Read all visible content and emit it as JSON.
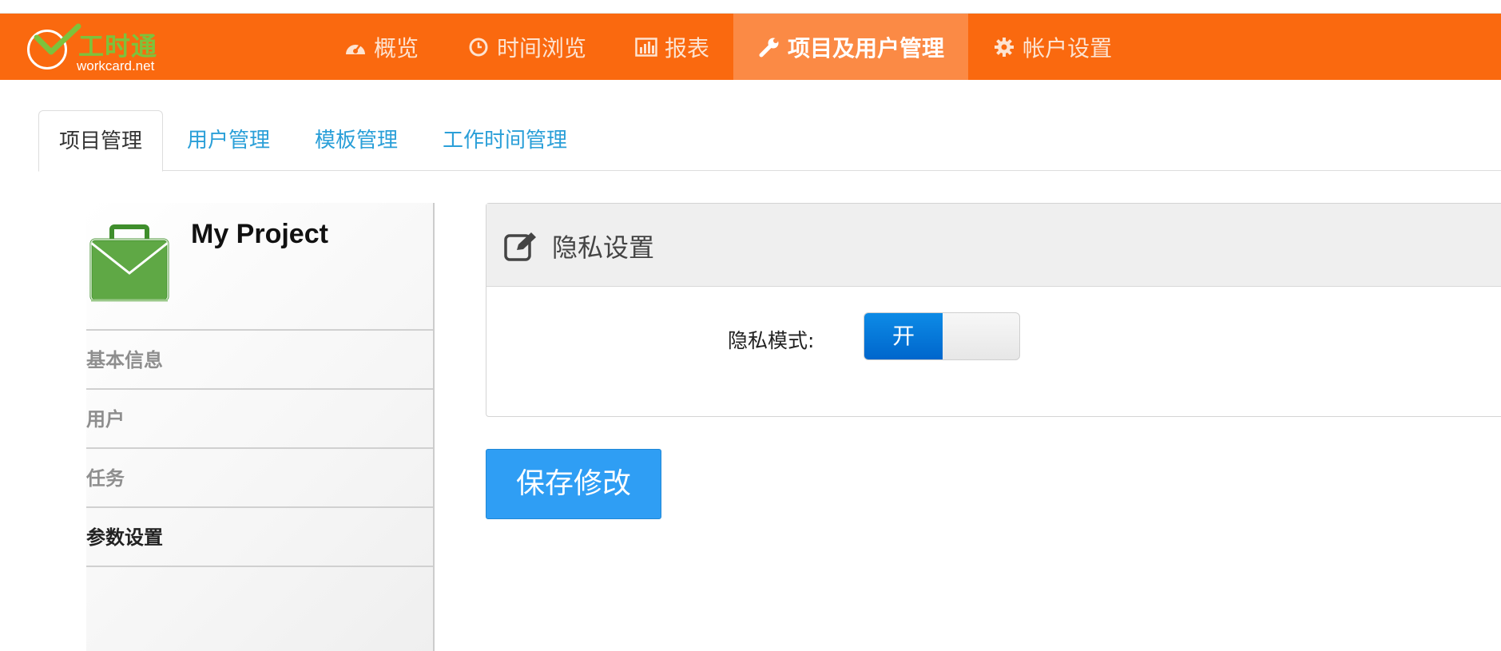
{
  "app": {
    "logo_cn": "工时通",
    "logo_en": "workcard.net"
  },
  "nav": {
    "items": [
      {
        "label": "概览",
        "icon": "dashboard-icon",
        "active": false
      },
      {
        "label": "时间浏览",
        "icon": "clock-icon",
        "active": false
      },
      {
        "label": "报表",
        "icon": "bar-chart-icon",
        "active": false
      },
      {
        "label": "项目及用户管理",
        "icon": "wrench-icon",
        "active": true
      },
      {
        "label": "帐户设置",
        "icon": "gear-icon",
        "active": false
      }
    ]
  },
  "tabs": [
    {
      "label": "项目管理",
      "active": true
    },
    {
      "label": "用户管理",
      "active": false
    },
    {
      "label": "模板管理",
      "active": false
    },
    {
      "label": "工作时间管理",
      "active": false
    }
  ],
  "sidebar": {
    "project_name": "My Project",
    "project_icon": "briefcase-icon",
    "items": [
      {
        "label": "基本信息",
        "active": false
      },
      {
        "label": "用户",
        "active": false
      },
      {
        "label": "任务",
        "active": false
      },
      {
        "label": "参数设置",
        "active": true
      }
    ]
  },
  "panel": {
    "title": "隐私设置",
    "icon": "edit-icon",
    "privacy_label": "隐私模式:",
    "toggle_on_label": "开",
    "toggle_state": true
  },
  "save_button": "保存修改",
  "colors": {
    "navbar": "#fa690f",
    "nav_active": "#fb8a45",
    "link": "#2a9fd8",
    "primary_button": "#2f9ef4",
    "toggle_on": "#0d7fe0"
  }
}
